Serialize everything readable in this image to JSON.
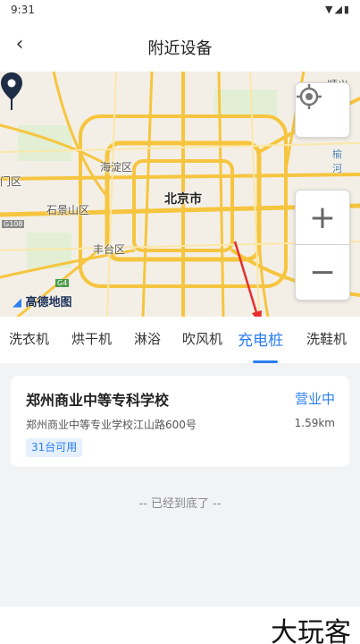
{
  "status_bar": {
    "time": "9:31",
    "icons": "▼◢▮"
  },
  "header": {
    "title": "附近设备",
    "back_icon": "‹"
  },
  "map": {
    "labels": {
      "haidian": "海淀区",
      "beijing": "北京市",
      "shijingshan": "石景山区",
      "fengtai": "丰台区",
      "west_district": "门区",
      "shunyi": "顺义",
      "yu": "榆",
      "he": "河",
      "logo": "高德地图"
    },
    "road_badges": {
      "a": "G108",
      "b": "G4"
    },
    "controls": {
      "zoom_in": "+",
      "zoom_out": "−"
    }
  },
  "tabs": [
    {
      "label": "洗衣机"
    },
    {
      "label": "烘干机"
    },
    {
      "label": "淋浴"
    },
    {
      "label": "吹风机"
    },
    {
      "label": "充电桩",
      "active": true
    },
    {
      "label": "洗鞋机"
    }
  ],
  "card": {
    "title": "郑州商业中等专科学校",
    "status": "营业中",
    "address": "郑州商业中等专业学校江山路600号",
    "distance": "1.59km",
    "badge": "31台可用"
  },
  "end_text": "-- 已经到底了 --",
  "watermark": "大玩客",
  "colors": {
    "accent": "#2a7ef0",
    "road": "#f6c53f",
    "annotation_arrow": "#e52f2f"
  }
}
